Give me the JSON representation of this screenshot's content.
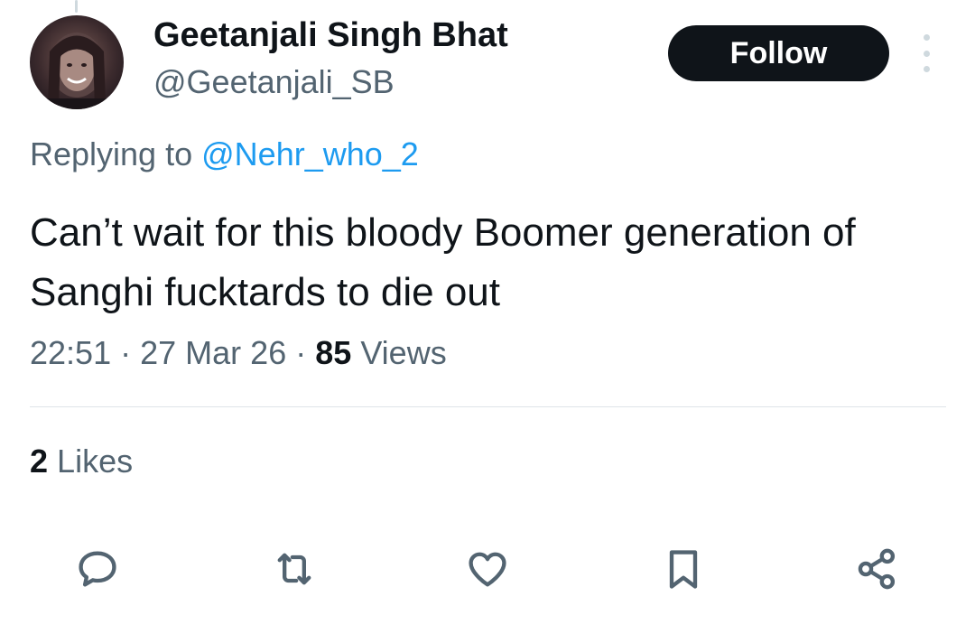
{
  "tweet": {
    "author": {
      "display_name": "Geetanjali Singh Bhat",
      "handle": "@Geetanjali_SB",
      "avatar_icon": "profile-photo"
    },
    "follow_label": "Follow",
    "replying_to_prefix": "Replying to",
    "replying_to_handle": "@Nehr_who_2",
    "text": "Can’t wait for this bloody Boomer generation of Sanghi fucktards to die out",
    "time": "22:51",
    "date": "27 Mar 26",
    "separator": "·",
    "views_count": "85",
    "views_label": "Views",
    "likes_count": "2",
    "likes_label": "Likes"
  },
  "actions": [
    {
      "name": "reply",
      "icon": "speech-bubble-icon"
    },
    {
      "name": "repost",
      "icon": "repost-arrows-icon"
    },
    {
      "name": "like",
      "icon": "heart-icon"
    },
    {
      "name": "bookmark",
      "icon": "bookmark-icon"
    },
    {
      "name": "share",
      "icon": "share-nodes-icon"
    }
  ],
  "colors": {
    "text_primary": "#0f1419",
    "text_secondary": "#536471",
    "link": "#1d9bf0",
    "button_bg": "#0f1419",
    "icon": "#536471"
  }
}
